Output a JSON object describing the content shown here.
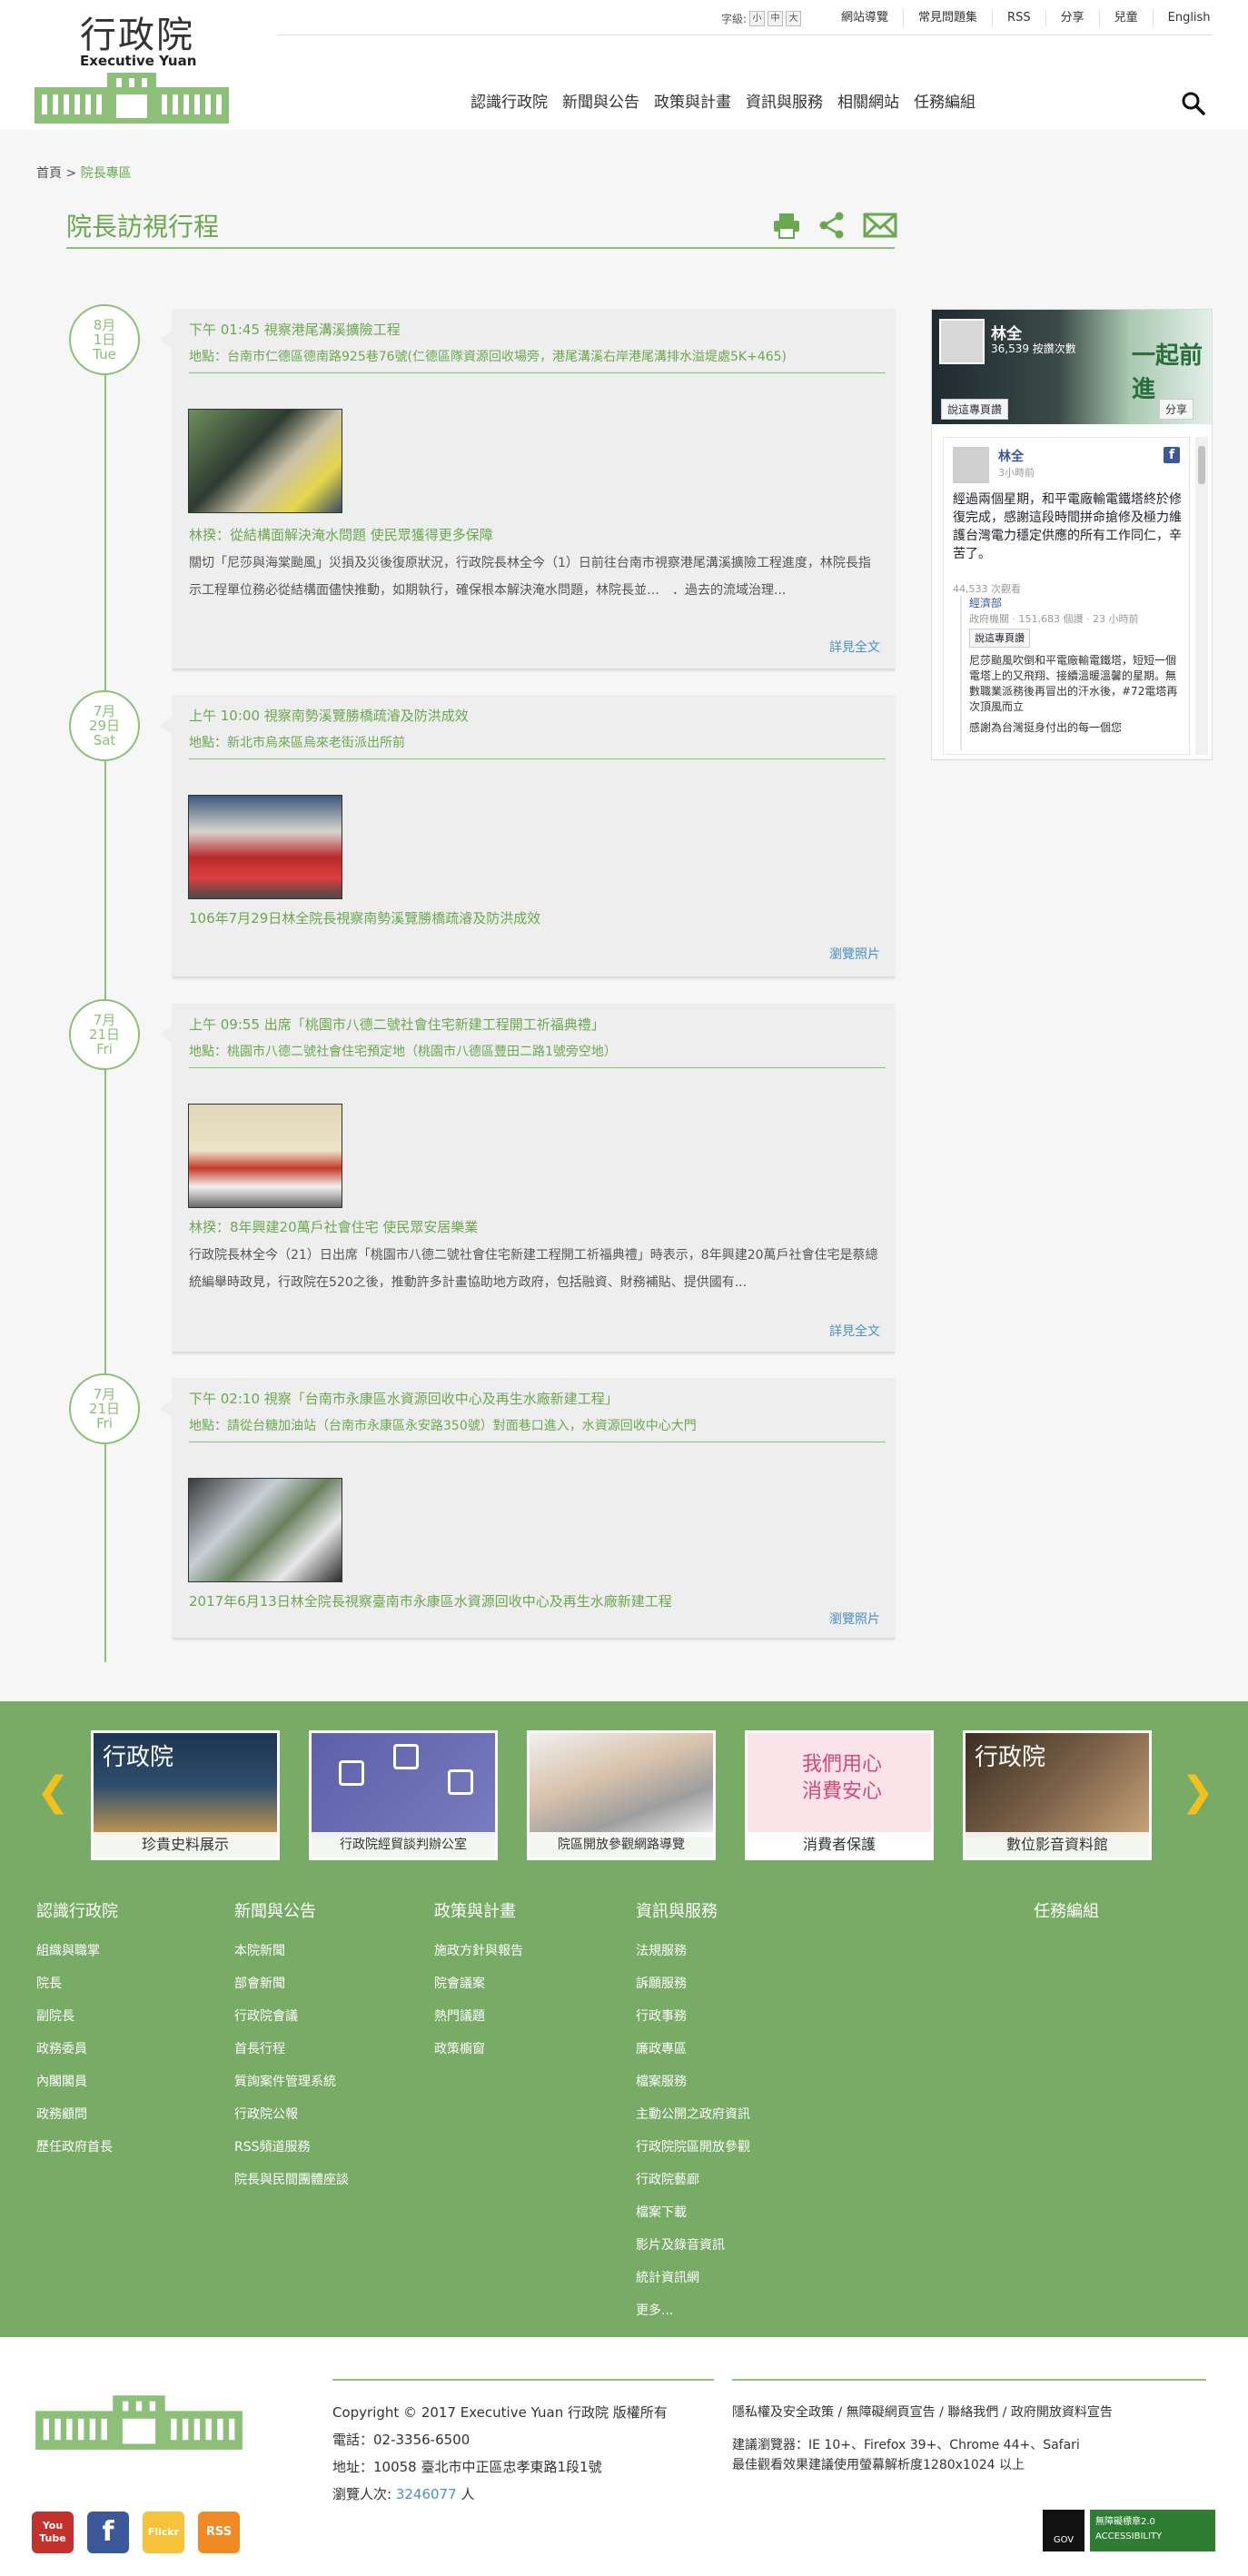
{
  "header": {
    "logo_cn": "行政院",
    "logo_en": "Executive Yuan",
    "fontsize": {
      "label": "字級:",
      "small": "小",
      "medium": "中",
      "large": "大"
    },
    "toplinks": [
      "網站導覽",
      "常見問題集",
      "RSS",
      "分享",
      "兒童",
      "English"
    ],
    "nav": [
      "認識行政院",
      "新聞與公告",
      "政策與計畫",
      "資訊與服務",
      "相關網站",
      "任務編組"
    ]
  },
  "breadcrumb": {
    "home": "首頁",
    "sep": ">",
    "current": "院長專區"
  },
  "page_title": "院長訪視行程",
  "timeline": [
    {
      "month": "8月",
      "day": "1日",
      "weekday": "Tue",
      "title": "下午 01:45 視察港尾溝溪擴險工程",
      "location": "地點：台南市仁德區德南路925巷76號(仁德區隊資源回收場旁，港尾溝溪右岸港尾溝排水溢堤處5K+465)",
      "subtitle": "林揆：從結構面解決淹水問題 使民眾獲得更多保障",
      "desc": "關切「尼莎與海棠颱風」災損及災後復原狀況，行政院長林全今（1）日前往台南市視察港尾溝溪擴險工程進度，林院長指示工程單位務必從結構面儘快推動，如期執行，確保根本解決淹水問題，林院長並…　．過去的流域治理...",
      "more": "詳見全文"
    },
    {
      "month": "7月",
      "day": "29日",
      "weekday": "Sat",
      "title": "上午 10:00 視察南勢溪覽勝橋疏濬及防洪成效",
      "location": "地點：新北市烏來區烏來老街派出所前",
      "subtitle": "106年7月29日林全院長視察南勢溪覽勝橋疏濬及防洪成效",
      "desc": "",
      "more": "瀏覽照片"
    },
    {
      "month": "7月",
      "day": "21日",
      "weekday": "Fri",
      "title": "上午 09:55 出席「桃園市八德二號社會住宅新建工程開工祈福典禮」",
      "location": "地點：桃園市八德二號社會住宅預定地（桃園市八德區豐田二路1號旁空地）",
      "subtitle": "林揆：8年興建20萬戶社會住宅 使民眾安居樂業",
      "desc": "行政院長林全今（21）日出席「桃園市八德二號社會住宅新建工程開工祈福典禮」時表示，8年興建20萬戶社會住宅是蔡總統編舉時政見，行政院在520之後，推動許多計畫協助地方政府，包括融資、財務補貼、提供國有...",
      "more": "詳見全文"
    },
    {
      "month": "7月",
      "day": "21日",
      "weekday": "Fri",
      "title": "下午 02:10 視察「台南市永康區水資源回收中心及再生水廠新建工程」",
      "location": "地點：請從台糖加油站（台南市永康區永安路350號）對面巷口進入，水資源回收中心大門",
      "subtitle": "2017年6月13日林全院長視察臺南市永康區水資源回收中心及再生水廠新建工程",
      "desc": "",
      "more": "瀏覽照片"
    }
  ],
  "facebook": {
    "name": "林全",
    "likes": "36,539 按讚次數",
    "slogan": "一起前進",
    "like_btn": "說這專頁讚",
    "share_btn": "分享",
    "post_name": "林全",
    "post_time": "3小時前",
    "post_text": "經過兩個星期，和平電廠輸電鐵塔終於修復完成，感謝這段時間拼命搶修及極力維護台灣電力穩定供應的所有工作同仁，辛苦了。",
    "views": "44,533 次觀看",
    "inner_name": "經濟部",
    "inner_meta": "政府機關 · 151,683 個讚 · 23 小時前",
    "inner_like": "說這專頁讚",
    "inner_text": "尼莎颱風吹倒和平電廠輸電鐵塔，短短一個電塔上的又飛翔、接續溫暖溫馨的星期。無數職業派務後再冒出的汗水後，#72電塔再次頂風而立",
    "inner_footer": "感謝為台灣挺身付出的每一個您"
  },
  "banners": [
    "珍貴史料展示",
    "行政院經貿談判辦公室",
    "院區開放參觀網路導覽",
    "消費者保護",
    "數位影音資料館"
  ],
  "banner_extra": {
    "logo": "行政院",
    "consumer": "我們用心\n消費安心"
  },
  "footer_cols": [
    {
      "title": "認識行政院",
      "items": [
        "組織與職掌",
        "院長",
        "副院長",
        "政務委員",
        "內閣閣員",
        "政務顧問",
        "歷任政府首長"
      ]
    },
    {
      "title": "新聞與公告",
      "items": [
        "本院新聞",
        "部會新聞",
        "行政院會議",
        "首長行程",
        "質詢案件管理系統",
        "行政院公報",
        "RSS頻道服務",
        "院長與民間團體座談"
      ]
    },
    {
      "title": "政策與計畫",
      "items": [
        "施政方針與報告",
        "院會議案",
        "熱門議題",
        "政策櫥窗"
      ]
    },
    {
      "title": "資訊與服務",
      "items": [
        "法規服務",
        "訴願服務",
        "行政事務",
        "廉政專區",
        "檔案服務",
        "主動公開之政府資訊",
        "行政院院區開放參觀",
        "行政院藝廊",
        "檔案下載",
        "影片及錄音資訊",
        "統計資訊網",
        "更多..."
      ]
    },
    {
      "title": "任務編組",
      "items": []
    }
  ],
  "bottom": {
    "copyright": "Copyright © 2017 Executive Yuan 行政院 版權所有",
    "phone": "電話：02-3356-6500",
    "address": "地址：10058 臺北市中正區忠孝東路1段1號",
    "visitors_label": "瀏覽人次:",
    "visitors": "3246077",
    "visitors_unit": "人",
    "links": "隱私權及安全政策 / 無障礙網頁宣告 / 聯絡我們 / 政府開放資料宣告",
    "browsers": "建議瀏覽器：IE 10+、Firefox 39+、Chrome 44+、Safari",
    "resolution": "最佳觀看效果建議使用螢幕解析度1280x1024 以上",
    "social": [
      "You Tube",
      "f",
      "Flickr",
      "RSS"
    ],
    "badge1": "GOV",
    "badge2": "無障礙標章2.0 ACCESSIBILITY"
  }
}
